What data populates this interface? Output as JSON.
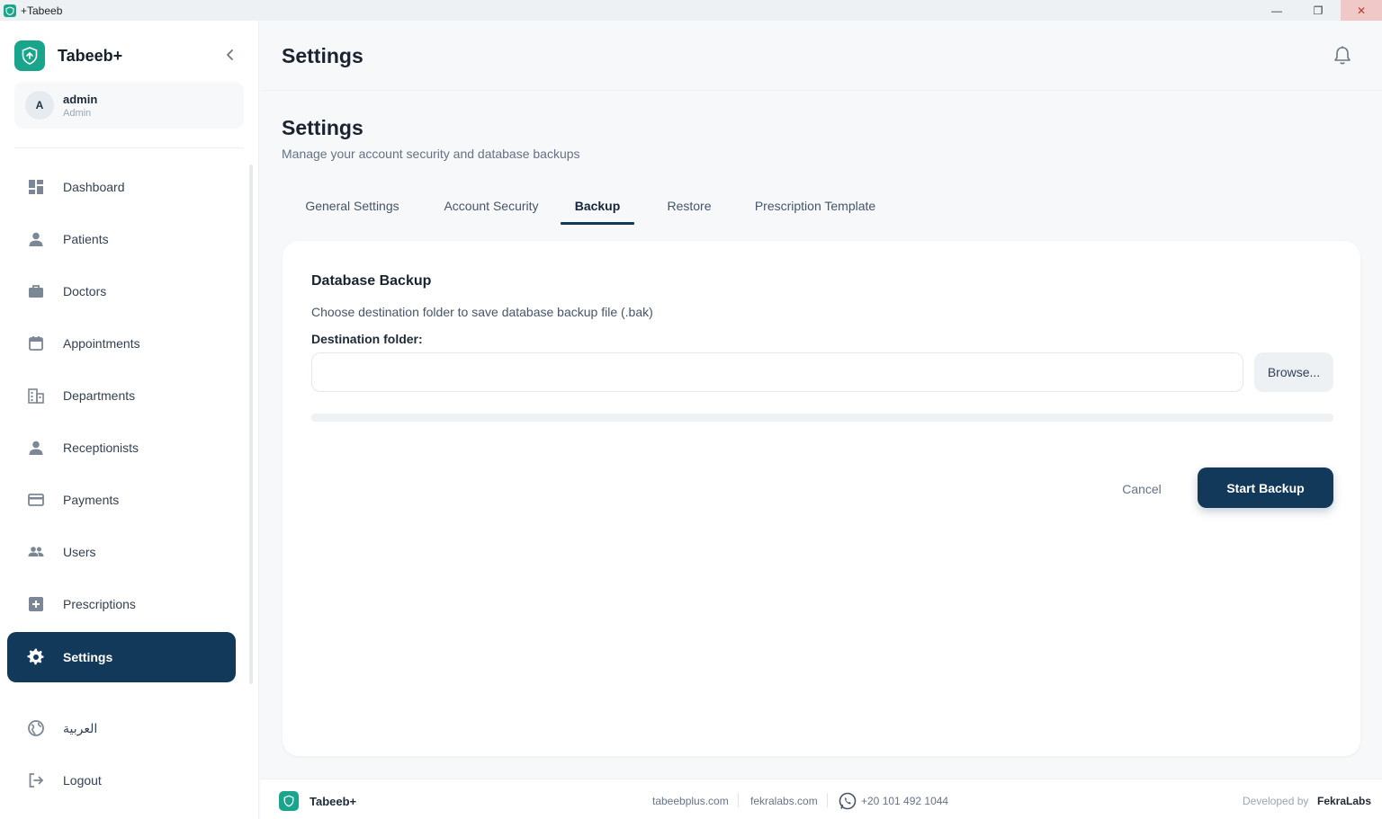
{
  "window": {
    "title": "+Tabeeb",
    "controls": {
      "minimize": "—",
      "maximize": "❐",
      "close": "✕"
    }
  },
  "sidebar": {
    "brand": "Tabeeb+",
    "user": {
      "initial": "A",
      "name": "admin",
      "role": "Admin"
    },
    "items": [
      {
        "label": "Dashboard",
        "icon": "dashboard-icon"
      },
      {
        "label": "Patients",
        "icon": "person-icon"
      },
      {
        "label": "Doctors",
        "icon": "briefcase-icon"
      },
      {
        "label": "Appointments",
        "icon": "calendar-icon"
      },
      {
        "label": "Departments",
        "icon": "building-icon"
      },
      {
        "label": "Receptionists",
        "icon": "person-icon"
      },
      {
        "label": "Payments",
        "icon": "credit-card-icon"
      },
      {
        "label": "Users",
        "icon": "users-icon"
      },
      {
        "label": "Prescriptions",
        "icon": "medical-plus-icon"
      },
      {
        "label": "Settings",
        "icon": "gear-icon",
        "active": true
      },
      {
        "label": "العربية",
        "icon": "globe-icon"
      },
      {
        "label": "Logout",
        "icon": "logout-icon"
      }
    ]
  },
  "header": {
    "title": "Settings"
  },
  "page": {
    "title": "Settings",
    "subtitle": "Manage your account security and database backups"
  },
  "tabs": [
    {
      "label": "General Settings"
    },
    {
      "label": "Account Security"
    },
    {
      "label": "Backup",
      "active": true
    },
    {
      "label": "Restore"
    },
    {
      "label": "Prescription Template"
    }
  ],
  "backup": {
    "title": "Database Backup",
    "description": "Choose destination folder to save database backup file (.bak)",
    "field_label": "Destination folder:",
    "destination_value": "",
    "browse_label": "Browse...",
    "progress": 0,
    "cancel_label": "Cancel",
    "start_label": "Start Backup"
  },
  "footer": {
    "brand": "Tabeeb+",
    "link1": "tabeebplus.com",
    "link2": "fekralabs.com",
    "phone": "+20 101 492 1044",
    "developed_by": "Developed by",
    "developer": "FekraLabs"
  },
  "colors": {
    "primary": "#13395a",
    "brand_green": "#18a58b",
    "background": "#f6f8fa"
  }
}
